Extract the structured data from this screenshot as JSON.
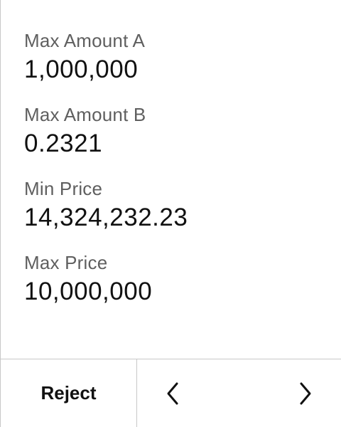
{
  "fields": [
    {
      "label": "Max Amount A",
      "value": "1,000,000"
    },
    {
      "label": "Max Amount B",
      "value": "0.2321"
    },
    {
      "label": "Min Price",
      "value": "14,324,232.23"
    },
    {
      "label": "Max Price",
      "value": "10,000,000"
    }
  ],
  "footer": {
    "reject_label": "Reject",
    "prev_icon": "chevron-left-icon",
    "next_icon": "chevron-right-icon"
  },
  "colors": {
    "label": "#5f5f5f",
    "value": "#111111",
    "divider": "#c8c8c8"
  }
}
